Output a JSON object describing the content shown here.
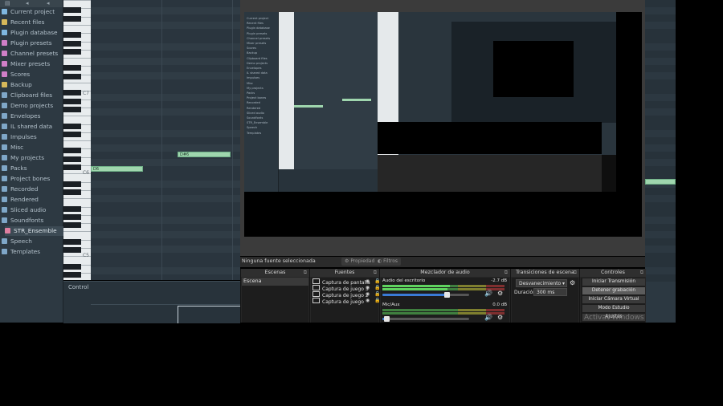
{
  "fl": {
    "browser": {
      "items": [
        {
          "label": "Current project",
          "color": "#7fb7e0"
        },
        {
          "label": "Recent files",
          "color": "#d6b85a"
        },
        {
          "label": "Plugin database",
          "color": "#7fb7e0"
        },
        {
          "label": "Plugin presets",
          "color": "#d07fc8"
        },
        {
          "label": "Channel presets",
          "color": "#d07fc8"
        },
        {
          "label": "Mixer presets",
          "color": "#d07fc8"
        },
        {
          "label": "Scores",
          "color": "#d07fc8"
        },
        {
          "label": "Backup",
          "color": "#d6b85a"
        },
        {
          "label": "Clipboard files",
          "color": "#7fa7c8"
        },
        {
          "label": "Demo projects",
          "color": "#7fa7c8"
        },
        {
          "label": "Envelopes",
          "color": "#7fa7c8"
        },
        {
          "label": "IL shared data",
          "color": "#7fa7c8"
        },
        {
          "label": "Impulses",
          "color": "#7fa7c8"
        },
        {
          "label": "Misc",
          "color": "#7fa7c8"
        },
        {
          "label": "My projects",
          "color": "#7fa7c8"
        },
        {
          "label": "Packs",
          "color": "#7fa7c8"
        },
        {
          "label": "Project bones",
          "color": "#7fa7c8"
        },
        {
          "label": "Recorded",
          "color": "#7fa7c8"
        },
        {
          "label": "Rendered",
          "color": "#7fa7c8"
        },
        {
          "label": "Sliced audio",
          "color": "#7fa7c8"
        },
        {
          "label": "Soundfonts",
          "color": "#7fa7c8"
        },
        {
          "label": "STR_Ensemble",
          "color": "#e07fa0",
          "selected": true
        },
        {
          "label": "Speech",
          "color": "#7fa7c8"
        },
        {
          "label": "Templates",
          "color": "#7fa7c8"
        }
      ]
    },
    "piano": {
      "labels": [
        "C7",
        "C6",
        "C5"
      ]
    },
    "notes": [
      "D6",
      "D#6"
    ],
    "control_label": "Control"
  },
  "obs": {
    "no_source": "Ninguna fuente seleccionada",
    "properties_label": "Propiedades",
    "filters_label": "Filtros",
    "scenes": {
      "title": "Escenas",
      "items": [
        "Escena"
      ]
    },
    "sources": {
      "title": "Fuentes",
      "items": [
        "Captura de pantalla",
        "Captura de juego 3",
        "Captura de juego 2",
        "Captura de juego"
      ]
    },
    "mixer": {
      "title": "Mezclador de audio",
      "channels": [
        {
          "name": "Audio del escritorio",
          "db": "-2.7 dB",
          "level": 0.55,
          "volume": 0.74
        },
        {
          "name": "Mic/Aux",
          "db": "0.0 dB",
          "level": 0.0,
          "volume": 0.05
        }
      ]
    },
    "transitions": {
      "title": "Transiciones de escena",
      "selected": "Desvanecimiento",
      "duration_label": "Duración",
      "duration_value": "300 ms"
    },
    "controls": {
      "title": "Controles",
      "buttons": [
        {
          "label": "Iniciar Transmisión",
          "active": false
        },
        {
          "label": "Detener grabación",
          "active": true
        },
        {
          "label": "Iniciar Cámara Virtual",
          "active": false
        },
        {
          "label": "Modo Estudio",
          "active": false
        },
        {
          "label": "Ajustes",
          "active": false
        }
      ]
    },
    "nested_browser": [
      "Current project",
      "Recent files",
      "Plugin database",
      "Plugin presets",
      "Channel presets",
      "Mixer presets",
      "Scores",
      "Backup",
      "Clipboard files",
      "Demo projects",
      "Envelopes",
      "IL shared data",
      "Impulses",
      "Misc",
      "My projects",
      "Packs",
      "Project bones",
      "Recorded",
      "Rendered",
      "Sliced audio",
      "Soundfonts",
      "STR_Ensemble",
      "Speech",
      "Templates"
    ]
  },
  "watermark": "Activar Windows"
}
